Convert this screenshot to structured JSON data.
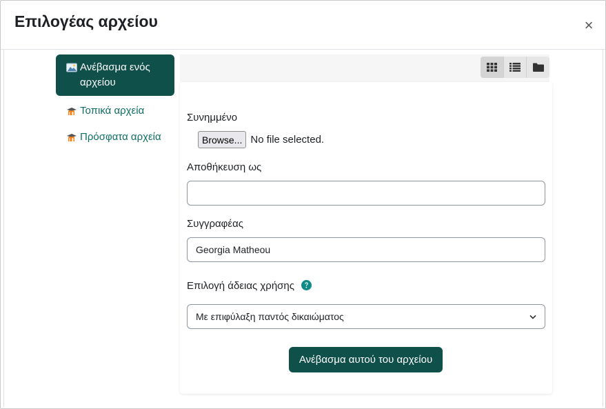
{
  "dialog": {
    "title": "Επιλογέας αρχείου",
    "close_glyph": "×"
  },
  "sidebar": {
    "items": [
      {
        "label": "Ανέβασμα ενός αρχείου",
        "icon": "upload-icon",
        "active": true
      },
      {
        "label": "Τοπικά αρχεία",
        "icon": "moodle-icon",
        "active": false
      },
      {
        "label": "Πρόσφατα αρχεία",
        "icon": "moodle-icon",
        "active": false
      }
    ]
  },
  "toolbar": {
    "views": [
      {
        "icon": "grid-icon",
        "active": true
      },
      {
        "icon": "list-icon",
        "active": false
      },
      {
        "icon": "folder-icon",
        "active": false
      }
    ]
  },
  "form": {
    "attachment_label": "Συνημμένο",
    "browse_label": "Browse...",
    "no_file_text": "No file selected.",
    "save_as_label": "Αποθήκευση ως",
    "save_as_value": "",
    "author_label": "Συγγραφέας",
    "author_value": "Georgia Matheou",
    "license_label": "Επιλογή άδειας χρήσης",
    "license_selected": "Με επιφύλαξη παντός δικαιώματος",
    "submit_label": "Ανέβασμα αυτού του αρχείου"
  },
  "colors": {
    "brand_dark": "#0f504a",
    "link_teal": "#0f6e63",
    "help_teal": "#0f8a87"
  }
}
